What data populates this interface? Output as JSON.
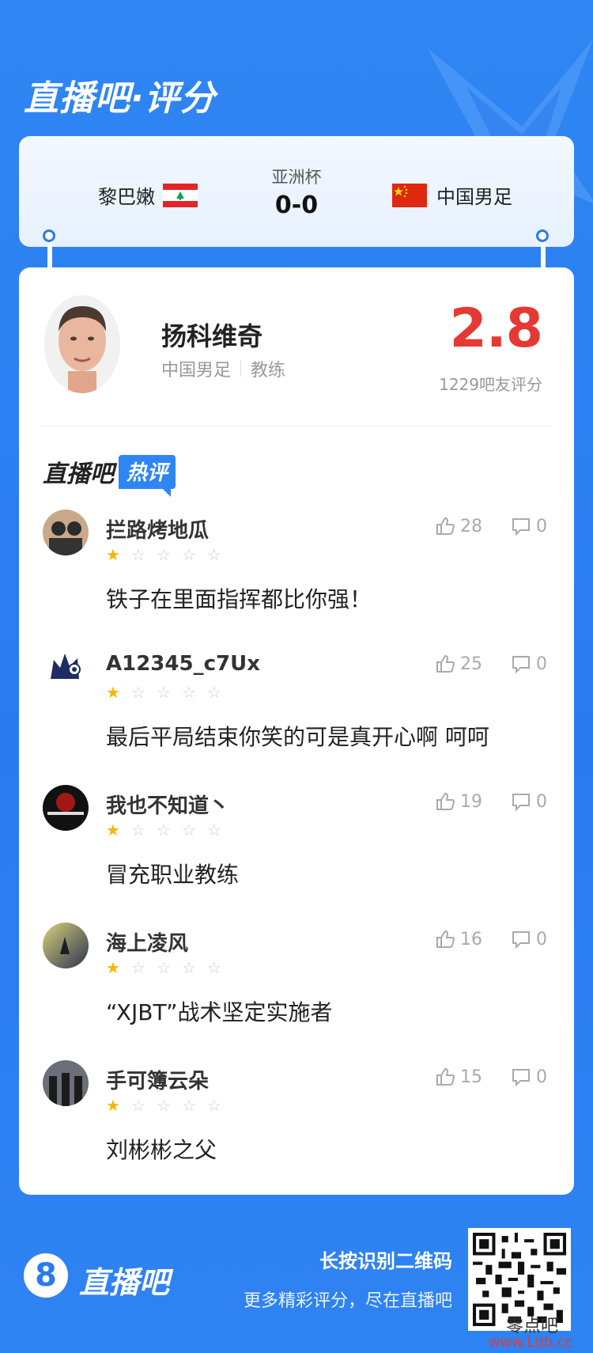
{
  "header": {
    "title": "直播吧·评分"
  },
  "match": {
    "competition": "亚洲杯",
    "score": "0-0",
    "home": {
      "name": "黎巴嫩",
      "flag": "lebanon-flag-icon"
    },
    "away": {
      "name": "中国男足",
      "flag": "china-flag-icon"
    }
  },
  "coach": {
    "name": "扬科维奇",
    "team": "中国男足",
    "role": "教练",
    "rating": "2.8",
    "rating_count": "1229吧友评分"
  },
  "hot": {
    "title": "直播吧",
    "tag": "热评"
  },
  "comments": [
    {
      "user": "拦路烤地瓜",
      "stars": 1,
      "text": "铁子在里面指挥都比你强！",
      "likes": "28",
      "replies": "0"
    },
    {
      "user": "A12345_c7Ux",
      "stars": 1,
      "text": "最后平局结束你笑的可是真开心啊 呵呵",
      "likes": "25",
      "replies": "0"
    },
    {
      "user": "我也不知道丶",
      "stars": 1,
      "text": "冒充职业教练",
      "likes": "19",
      "replies": "0"
    },
    {
      "user": "海上凌风",
      "stars": 1,
      "text": "“XJBT”战术坚定实施者",
      "likes": "16",
      "replies": "0"
    },
    {
      "user": "手可簿云朵",
      "stars": 1,
      "text": "刘彬彬之父",
      "likes": "15",
      "replies": "0"
    }
  ],
  "footer": {
    "logo_mark": "8",
    "logo_text": "直播吧",
    "line1": "长按识别二维码",
    "line2": "更多精彩评分，尽在直播吧"
  },
  "watermark": {
    "line1": "零点吧",
    "line2": "www.Ldb.cc"
  },
  "colors": {
    "brand_blue": "#2a7bef",
    "rating_red": "#e53935",
    "star_gold": "#f7b500"
  }
}
